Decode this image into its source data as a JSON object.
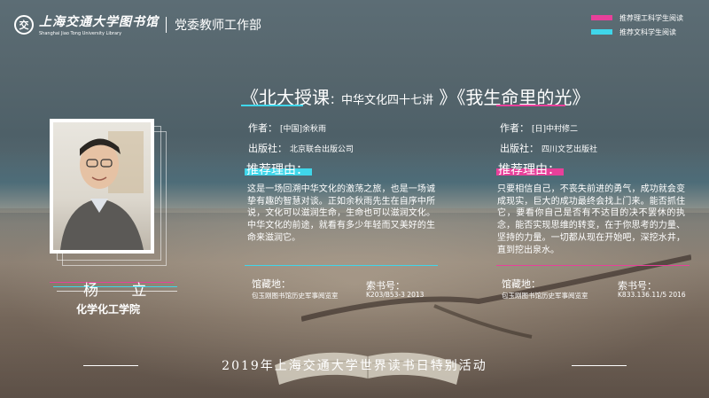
{
  "header": {
    "logo_cn": "上海交通大学图书馆",
    "logo_en": "Shanghai Jiao Tong University Library",
    "department": "党委教师工作部"
  },
  "legend": [
    {
      "label": "推荐理工科学生阅读",
      "color": "#e8409a"
    },
    {
      "label": "推荐文科学生阅读",
      "color": "#3fd6ea"
    }
  ],
  "recommender": {
    "name": "杨 立",
    "college": "化学化工学院"
  },
  "title": {
    "book1": "《北大授课",
    "book1_colon": "：",
    "book1_sub": "中华文化四十七讲",
    "book1_close": "》",
    "book2": "《我生命里的光》"
  },
  "books": [
    {
      "author_label": "作者：",
      "author": "[中国]余秋雨",
      "publisher_label": "出版社：",
      "publisher": "北京联合出版公司",
      "reason_label": "推荐理由：",
      "reason": "这是一场回溯中华文化的激荡之旅，也是一场诚挚有趣的智慧对谈。正如余秋雨先生在自序中所说，文化可以滋润生命，生命也可以滋润文化。中华文化的前途，就看有多少年轻而又美好的生命来滋润它。",
      "location_label": "馆藏地：",
      "location": "包玉刚图书馆历史军事阅览室",
      "callno_label": "索书号：",
      "callno": "K203/B53-3 2013",
      "color": "#3fd6ea"
    },
    {
      "author_label": "作者：",
      "author": "[日]中村修二",
      "publisher_label": "出版社：",
      "publisher": "四川文艺出版社",
      "reason_label": "推荐理由：",
      "reason": "只要相信自己，不丧失前进的勇气，成功就会变成现实，巨大的成功最终会找上门来。能否抓住它，要看你自己是否有不达目的决不罢休的执念，能否实现思维的转变，在于你思考的力量、坚持的力量。一切都从现在开始吧，深挖水井，直到挖出泉水。",
      "location_label": "馆藏地：",
      "location": "包玉刚图书馆历史军事阅览室",
      "callno_label": "索书号：",
      "callno": "K833.136.11/5 2016",
      "color": "#e8409a"
    }
  ],
  "footer": "2019年上海交通大学世界读书日特别活动"
}
